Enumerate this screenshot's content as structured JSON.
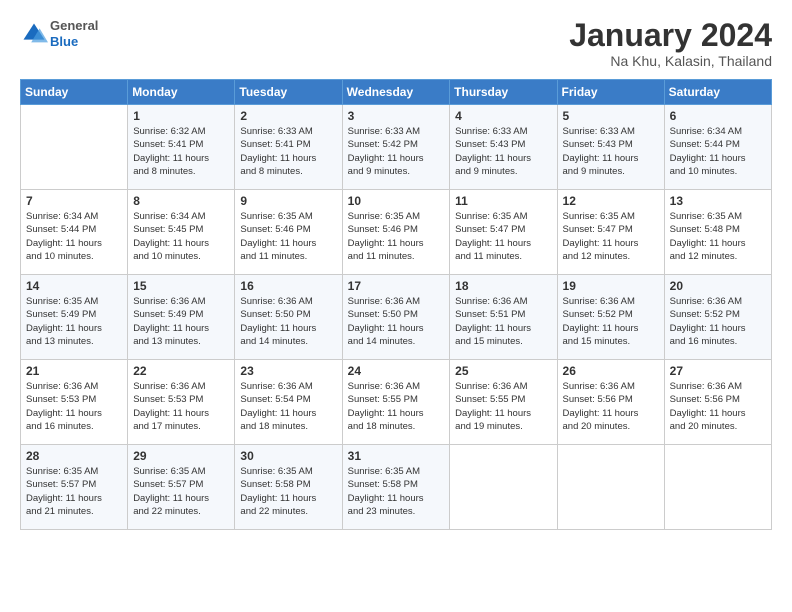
{
  "header": {
    "logo": {
      "general": "General",
      "blue": "Blue"
    },
    "title": "January 2024",
    "location": "Na Khu, Kalasin, Thailand"
  },
  "calendar": {
    "days_of_week": [
      "Sunday",
      "Monday",
      "Tuesday",
      "Wednesday",
      "Thursday",
      "Friday",
      "Saturday"
    ],
    "weeks": [
      [
        {
          "day": "",
          "info": ""
        },
        {
          "day": "1",
          "info": "Sunrise: 6:32 AM\nSunset: 5:41 PM\nDaylight: 11 hours\nand 8 minutes."
        },
        {
          "day": "2",
          "info": "Sunrise: 6:33 AM\nSunset: 5:41 PM\nDaylight: 11 hours\nand 8 minutes."
        },
        {
          "day": "3",
          "info": "Sunrise: 6:33 AM\nSunset: 5:42 PM\nDaylight: 11 hours\nand 9 minutes."
        },
        {
          "day": "4",
          "info": "Sunrise: 6:33 AM\nSunset: 5:43 PM\nDaylight: 11 hours\nand 9 minutes."
        },
        {
          "day": "5",
          "info": "Sunrise: 6:33 AM\nSunset: 5:43 PM\nDaylight: 11 hours\nand 9 minutes."
        },
        {
          "day": "6",
          "info": "Sunrise: 6:34 AM\nSunset: 5:44 PM\nDaylight: 11 hours\nand 10 minutes."
        }
      ],
      [
        {
          "day": "7",
          "info": "Sunrise: 6:34 AM\nSunset: 5:44 PM\nDaylight: 11 hours\nand 10 minutes."
        },
        {
          "day": "8",
          "info": "Sunrise: 6:34 AM\nSunset: 5:45 PM\nDaylight: 11 hours\nand 10 minutes."
        },
        {
          "day": "9",
          "info": "Sunrise: 6:35 AM\nSunset: 5:46 PM\nDaylight: 11 hours\nand 11 minutes."
        },
        {
          "day": "10",
          "info": "Sunrise: 6:35 AM\nSunset: 5:46 PM\nDaylight: 11 hours\nand 11 minutes."
        },
        {
          "day": "11",
          "info": "Sunrise: 6:35 AM\nSunset: 5:47 PM\nDaylight: 11 hours\nand 11 minutes."
        },
        {
          "day": "12",
          "info": "Sunrise: 6:35 AM\nSunset: 5:47 PM\nDaylight: 11 hours\nand 12 minutes."
        },
        {
          "day": "13",
          "info": "Sunrise: 6:35 AM\nSunset: 5:48 PM\nDaylight: 11 hours\nand 12 minutes."
        }
      ],
      [
        {
          "day": "14",
          "info": "Sunrise: 6:35 AM\nSunset: 5:49 PM\nDaylight: 11 hours\nand 13 minutes."
        },
        {
          "day": "15",
          "info": "Sunrise: 6:36 AM\nSunset: 5:49 PM\nDaylight: 11 hours\nand 13 minutes."
        },
        {
          "day": "16",
          "info": "Sunrise: 6:36 AM\nSunset: 5:50 PM\nDaylight: 11 hours\nand 14 minutes."
        },
        {
          "day": "17",
          "info": "Sunrise: 6:36 AM\nSunset: 5:50 PM\nDaylight: 11 hours\nand 14 minutes."
        },
        {
          "day": "18",
          "info": "Sunrise: 6:36 AM\nSunset: 5:51 PM\nDaylight: 11 hours\nand 15 minutes."
        },
        {
          "day": "19",
          "info": "Sunrise: 6:36 AM\nSunset: 5:52 PM\nDaylight: 11 hours\nand 15 minutes."
        },
        {
          "day": "20",
          "info": "Sunrise: 6:36 AM\nSunset: 5:52 PM\nDaylight: 11 hours\nand 16 minutes."
        }
      ],
      [
        {
          "day": "21",
          "info": "Sunrise: 6:36 AM\nSunset: 5:53 PM\nDaylight: 11 hours\nand 16 minutes."
        },
        {
          "day": "22",
          "info": "Sunrise: 6:36 AM\nSunset: 5:53 PM\nDaylight: 11 hours\nand 17 minutes."
        },
        {
          "day": "23",
          "info": "Sunrise: 6:36 AM\nSunset: 5:54 PM\nDaylight: 11 hours\nand 18 minutes."
        },
        {
          "day": "24",
          "info": "Sunrise: 6:36 AM\nSunset: 5:55 PM\nDaylight: 11 hours\nand 18 minutes."
        },
        {
          "day": "25",
          "info": "Sunrise: 6:36 AM\nSunset: 5:55 PM\nDaylight: 11 hours\nand 19 minutes."
        },
        {
          "day": "26",
          "info": "Sunrise: 6:36 AM\nSunset: 5:56 PM\nDaylight: 11 hours\nand 20 minutes."
        },
        {
          "day": "27",
          "info": "Sunrise: 6:36 AM\nSunset: 5:56 PM\nDaylight: 11 hours\nand 20 minutes."
        }
      ],
      [
        {
          "day": "28",
          "info": "Sunrise: 6:35 AM\nSunset: 5:57 PM\nDaylight: 11 hours\nand 21 minutes."
        },
        {
          "day": "29",
          "info": "Sunrise: 6:35 AM\nSunset: 5:57 PM\nDaylight: 11 hours\nand 22 minutes."
        },
        {
          "day": "30",
          "info": "Sunrise: 6:35 AM\nSunset: 5:58 PM\nDaylight: 11 hours\nand 22 minutes."
        },
        {
          "day": "31",
          "info": "Sunrise: 6:35 AM\nSunset: 5:58 PM\nDaylight: 11 hours\nand 23 minutes."
        },
        {
          "day": "",
          "info": ""
        },
        {
          "day": "",
          "info": ""
        },
        {
          "day": "",
          "info": ""
        }
      ]
    ]
  }
}
